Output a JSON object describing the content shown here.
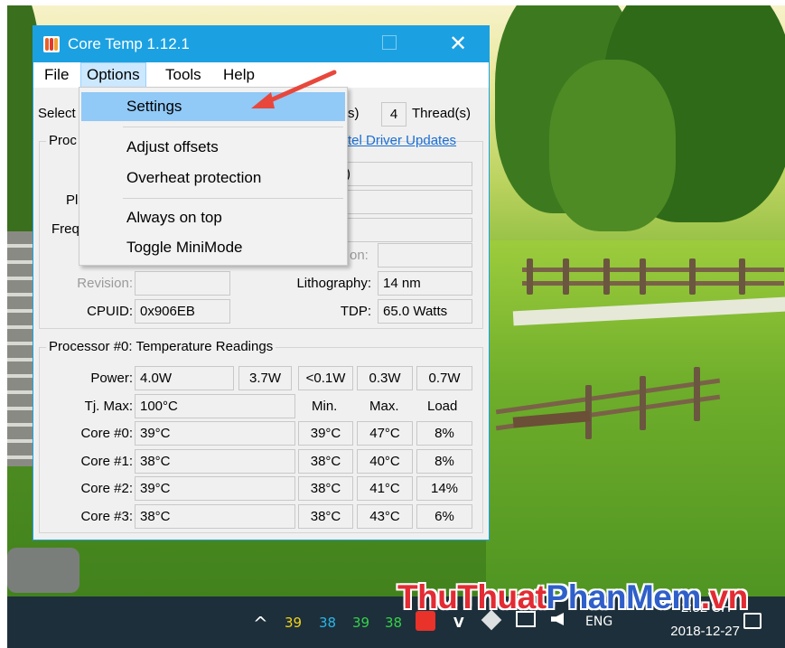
{
  "window": {
    "title": "Core Temp 1.12.1",
    "close_glyph": "✕",
    "accent_color": "#1ba1e2"
  },
  "menubar": {
    "items": [
      "File",
      "Options",
      "Tools",
      "Help"
    ],
    "open_menu": "Options"
  },
  "options_menu": {
    "items": [
      "Settings",
      "Adjust offsets",
      "Overheat protection",
      "Always on top",
      "Toggle MiniMode"
    ],
    "highlighted": "Settings"
  },
  "cpu_select": {
    "label_partial": "Select",
    "cores_partial": "s)",
    "threads_value": "4",
    "threads_label": "Thread(s)"
  },
  "processor_info": {
    "group_title_partial": "Proc",
    "driver_link_partial": "tel Driver Updates",
    "platform_label_partial": "Pl",
    "frequency_label_partial": "Freq",
    "model_value_partial": ")",
    "revision_label": "Revision:",
    "revision_value": "",
    "lithography_label": "Lithography:",
    "lithography_value": "14 nm",
    "cpuid_label": "CPUID:",
    "cpuid_value": "0x906EB",
    "tdp_label": "TDP:",
    "tdp_value": "65.0 Watts",
    "production_label_partial": "on:"
  },
  "temperature": {
    "group_title": "Processor #0: Temperature Readings",
    "power_label": "Power:",
    "power_values": [
      "4.0W",
      "3.7W",
      "<0.1W",
      "0.3W",
      "0.7W"
    ],
    "tjmax_label": "Tj. Max:",
    "tjmax_value": "100°C",
    "headers": [
      "Min.",
      "Max.",
      "Load"
    ],
    "cores": [
      {
        "label": "Core #0:",
        "temp": "39°C",
        "min": "39°C",
        "max": "47°C",
        "load": "8%"
      },
      {
        "label": "Core #1:",
        "temp": "38°C",
        "min": "38°C",
        "max": "40°C",
        "load": "8%"
      },
      {
        "label": "Core #2:",
        "temp": "39°C",
        "min": "38°C",
        "max": "41°C",
        "load": "14%"
      },
      {
        "label": "Core #3:",
        "temp": "38°C",
        "min": "38°C",
        "max": "43°C",
        "load": "6%"
      }
    ]
  },
  "taskbar": {
    "chevron": "^",
    "tray_temps": [
      {
        "value": "39",
        "color": "#f2d21b"
      },
      {
        "value": "38",
        "color": "#29b6e8"
      },
      {
        "value": "39",
        "color": "#35d14a"
      },
      {
        "value": "38",
        "color": "#35d14a"
      }
    ],
    "language": "ENG",
    "time": "2:52 CH",
    "date": "2018-12-27"
  },
  "watermark": {
    "part1": "ThuThuat",
    "part2": "PhanMem",
    "part3": ".vn"
  }
}
